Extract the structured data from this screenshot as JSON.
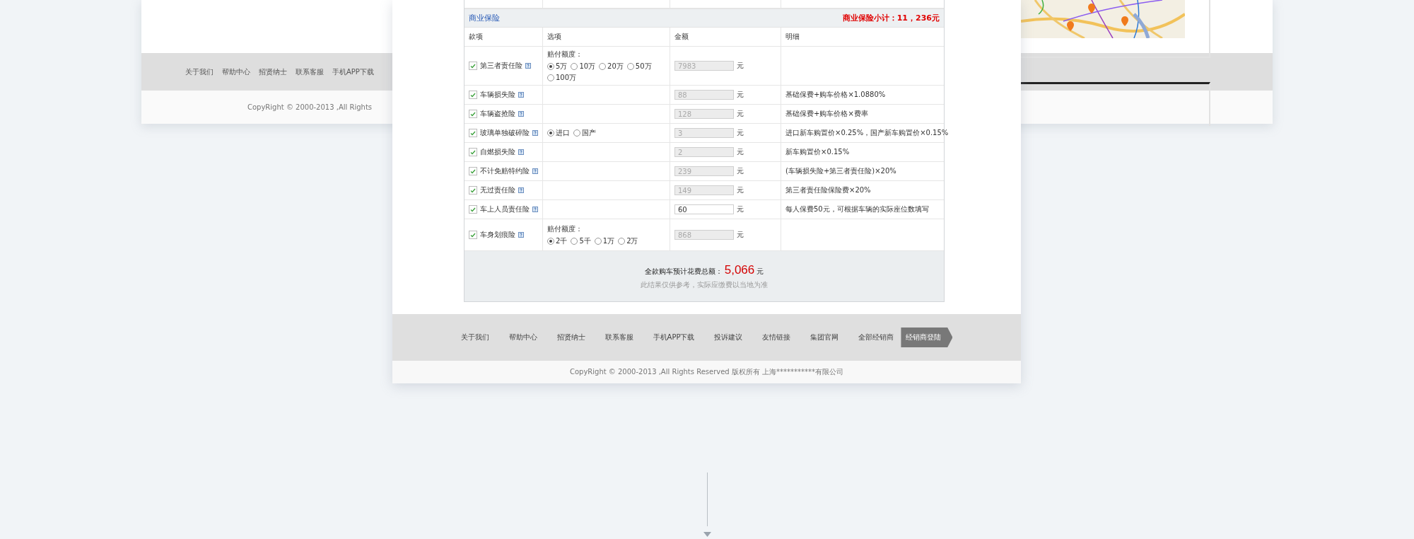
{
  "back_card": {
    "footer_links": [
      "关于我们",
      "帮助中心",
      "招贤纳士",
      "联系客服",
      "手机APP下载"
    ],
    "copyright": "CopyRight © 2000-2013 ,All Rights"
  },
  "commercial_insurance": {
    "title": "商业保险",
    "subtotal": "商业保险小计：11，236元",
    "columns": [
      "款项",
      "选项",
      "金额",
      "明细"
    ],
    "rows": [
      {
        "name": "第三者责任险",
        "checked": true,
        "option": {
          "kind": "radio",
          "label": "赔付额度：",
          "choices": [
            {
              "label": "5万",
              "selected": true
            },
            {
              "label": "10万",
              "selected": false
            },
            {
              "label": "20万",
              "selected": false
            },
            {
              "label": "50万",
              "selected": false
            },
            {
              "label": "100万",
              "selected": false
            }
          ]
        },
        "amount": "7983",
        "disabled": true,
        "unit": "元"
      },
      {
        "name": "车辆损失险",
        "checked": true,
        "amount": "88",
        "disabled": true,
        "unit": "元",
        "detail": "基础保费+购车价格×1.0880%"
      },
      {
        "name": "车辆盗抢险",
        "checked": true,
        "amount": "128",
        "disabled": true,
        "unit": "元",
        "detail": "基础保费+购车价格×费率"
      },
      {
        "name": "玻璃单独破碎险",
        "checked": true,
        "option": {
          "kind": "radio",
          "choices": [
            {
              "label": "进口",
              "selected": true
            },
            {
              "label": "国产",
              "selected": false
            }
          ]
        },
        "amount": "3",
        "disabled": true,
        "unit": "元",
        "detail": "进口新车购置价×0.25%，国产新车购置价×0.15%"
      },
      {
        "name": "自燃损失险",
        "checked": true,
        "amount": "2",
        "disabled": true,
        "unit": "元",
        "detail": "新车购置价×0.15%"
      },
      {
        "name": "不计免赔特约险",
        "checked": true,
        "amount": "239",
        "disabled": true,
        "unit": "元",
        "detail": "(车辆损失险+第三者责任险)×20%"
      },
      {
        "name": "无过责任险",
        "checked": true,
        "amount": "149",
        "disabled": true,
        "unit": "元",
        "detail": "第三者责任险保险费×20%"
      },
      {
        "name": "车上人员责任险",
        "checked": true,
        "amount": "60",
        "disabled": false,
        "unit": "元",
        "detail": "每人保费50元，可根据车辆的实际座位数填写"
      },
      {
        "name": "车身划痕险",
        "checked": true,
        "option": {
          "kind": "radio",
          "label": "赔付额度：",
          "choices": [
            {
              "label": "2千",
              "selected": true
            },
            {
              "label": "5千",
              "selected": false
            },
            {
              "label": "1万",
              "selected": false
            },
            {
              "label": "2万",
              "selected": false
            }
          ]
        },
        "amount": "868",
        "disabled": true,
        "unit": "元"
      }
    ]
  },
  "total": {
    "label": "全款购车预计花费总额：",
    "amount": "5,066",
    "unit": "元",
    "note": "此结果仅供参考，实际应缴费以当地为准"
  },
  "footer": {
    "links": [
      {
        "label": "关于我们",
        "kind": "link"
      },
      {
        "label": "帮助中心",
        "kind": "link"
      },
      {
        "label": "招贤纳士",
        "kind": "link"
      },
      {
        "label": "联系客服",
        "kind": "link"
      },
      {
        "label": "手机APP下载",
        "kind": "link"
      },
      {
        "label": "投诉建议",
        "kind": "link"
      },
      {
        "label": "友情链接",
        "kind": "link"
      },
      {
        "label": "集团官网",
        "kind": "link"
      },
      {
        "label": "全部经销商",
        "kind": "link"
      },
      {
        "label": "经销商登陆",
        "kind": "button"
      }
    ],
    "copyright": "CopyRight © 2000-2013 ,All Rights Reserved 版权所有 上海***********有限公司"
  }
}
